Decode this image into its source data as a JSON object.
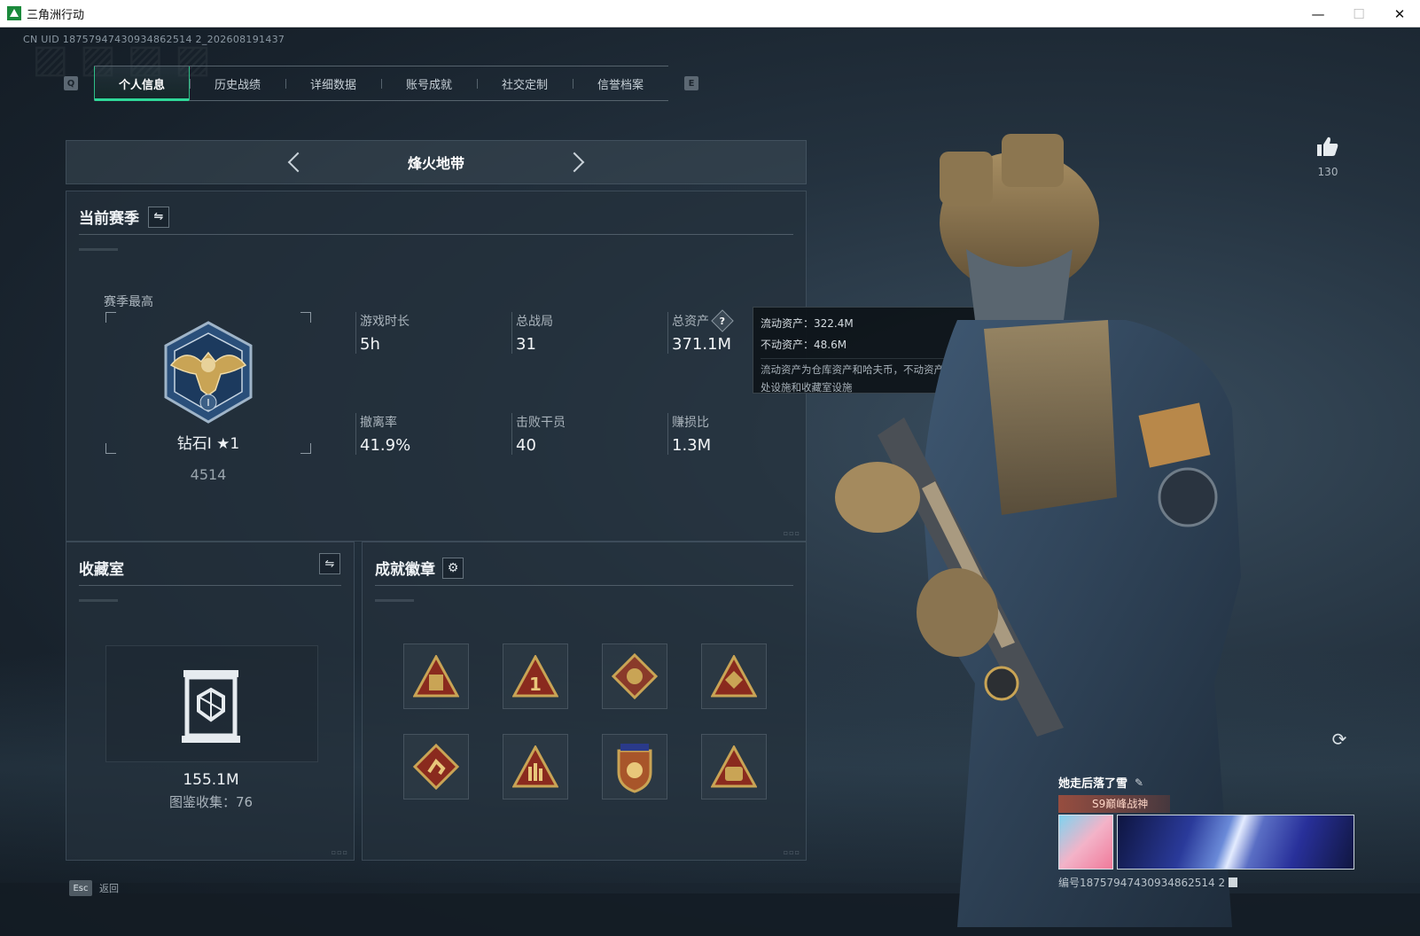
{
  "window": {
    "title": "三角洲行动",
    "minimize": "—",
    "maximize": "☐",
    "close": "✕"
  },
  "uid_text": "CN UID 18757947430934862514 2_202608191437",
  "tabs": {
    "key_left": "Q",
    "key_right": "E",
    "items": [
      {
        "label": "个人信息",
        "active": true
      },
      {
        "label": "历史战绩",
        "active": false
      },
      {
        "label": "详细数据",
        "active": false
      },
      {
        "label": "账号成就",
        "active": false
      },
      {
        "label": "社交定制",
        "active": false
      },
      {
        "label": "信誉档案",
        "active": false
      }
    ]
  },
  "mode": {
    "label": "烽火地带"
  },
  "season": {
    "title": "当前赛季",
    "best_label": "赛季最高",
    "rank_name": "钻石I ★1",
    "rank_score": "4514",
    "stats": [
      {
        "label": "游戏时长",
        "value": "5h"
      },
      {
        "label": "总战局",
        "value": "31"
      },
      {
        "label": "总资产",
        "value": "371.1M"
      },
      {
        "label": "撤离率",
        "value": "41.9%"
      },
      {
        "label": "击败干员",
        "value": "40"
      },
      {
        "label": "赚损比",
        "value": "1.3M"
      }
    ]
  },
  "tooltip": {
    "liquid": "流动资产：322.4M",
    "fixed": "不动资产：48.6M",
    "desc": "流动资产为仓库资产和哈夫币，不动资产为特勤处设施和收藏室设施"
  },
  "collection": {
    "title": "收藏室",
    "value": "155.1M",
    "count": "图鉴收集：76"
  },
  "badges": {
    "title": "成就徽章"
  },
  "likes": {
    "count": "130"
  },
  "card": {
    "name": "她走后落了雪",
    "title": "S9巅峰战神",
    "id": "编号18757947430934862514 2"
  },
  "footer": {
    "esc_key": "Esc",
    "esc_label": "返回"
  },
  "colors": {
    "accent": "#2fd899",
    "gold": "#c9a455",
    "badge_red": "#8a2a1e"
  }
}
